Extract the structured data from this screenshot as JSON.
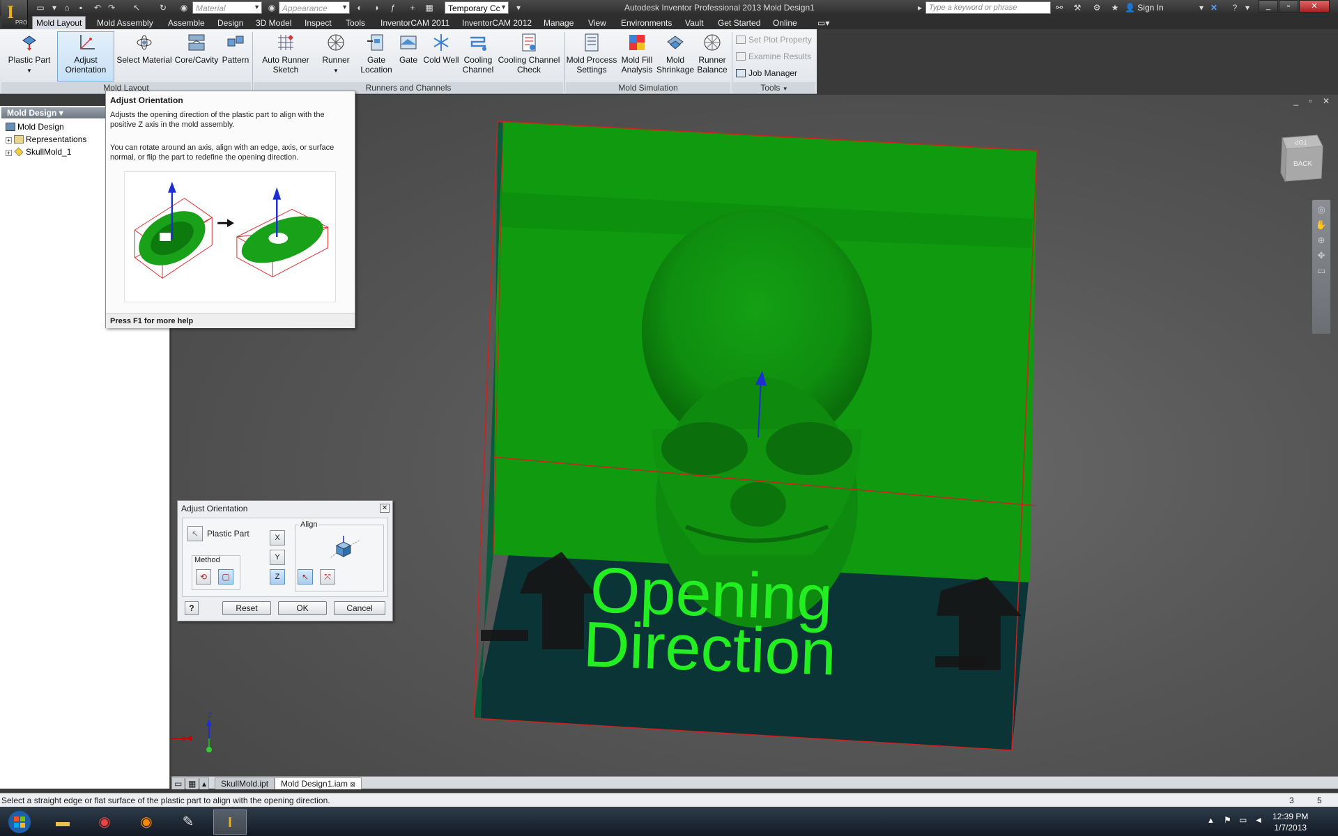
{
  "window": {
    "title": "Autodesk Inventor Professional 2013   Mold Design1",
    "app_badge": "PRO"
  },
  "quick_access": {
    "material_placeholder": "Material",
    "appearance_placeholder": "Appearance",
    "temp_combo": "Temporary Cc"
  },
  "search": {
    "placeholder": "Type a keyword or phrase"
  },
  "user": {
    "signin": "Sign In"
  },
  "tabs": [
    {
      "label": "Mold Layout"
    },
    {
      "label": "Mold Assembly"
    },
    {
      "label": "Assemble"
    },
    {
      "label": "Design"
    },
    {
      "label": "3D Model"
    },
    {
      "label": "Inspect"
    },
    {
      "label": "Tools"
    },
    {
      "label": "InventorCAM 2011"
    },
    {
      "label": "InventorCAM 2012"
    },
    {
      "label": "Manage"
    },
    {
      "label": "View"
    },
    {
      "label": "Environments"
    },
    {
      "label": "Vault"
    },
    {
      "label": "Get Started"
    },
    {
      "label": "Online"
    }
  ],
  "ribbon": {
    "mold_layout": [
      {
        "line1": "Plastic Part",
        "line2": ""
      },
      {
        "line1": "Adjust",
        "line2": "Orientation"
      },
      {
        "line1": "Select Material",
        "line2": ""
      },
      {
        "line1": "Core/Cavity",
        "line2": ""
      },
      {
        "line1": "Pattern",
        "line2": ""
      }
    ],
    "runners": [
      {
        "line1": "Auto Runner",
        "line2": "Sketch"
      },
      {
        "line1": "Runner",
        "line2": ""
      },
      {
        "line1": "Gate",
        "line2": "Location"
      },
      {
        "line1": "Gate",
        "line2": ""
      },
      {
        "line1": "Cold Well",
        "line2": ""
      },
      {
        "line1": "Cooling",
        "line2": "Channel"
      },
      {
        "line1": "Cooling Channel",
        "line2": "Check"
      }
    ],
    "simulation": [
      {
        "line1": "Mold Process",
        "line2": "Settings"
      },
      {
        "line1": "Mold Fill",
        "line2": "Analysis"
      },
      {
        "line1": "Mold",
        "line2": "Shrinkage"
      },
      {
        "line1": "Runner",
        "line2": "Balance"
      }
    ],
    "tools": {
      "set_plot": "Set Plot Property",
      "examine": "Examine Results",
      "job_manager": "Job Manager"
    },
    "panels": {
      "mold_layout": "Mold Layout",
      "runners": "Runners and Channels",
      "simulation": "Mold Simulation",
      "tools": "Tools"
    }
  },
  "browser": {
    "header": "Mold Design",
    "items": [
      {
        "label": "Mold Design"
      },
      {
        "label": "Representations"
      },
      {
        "label": "SkullMold_1"
      }
    ]
  },
  "tooltip": {
    "title": "Adjust Orientation",
    "p1": "Adjusts the opening direction of the plastic part to align with the positive Z axis in the mold assembly.",
    "p2": "You can rotate around an axis, align with an edge, axis, or surface normal, or flip the part to redefine the opening direction.",
    "footer": "Press F1 for more help"
  },
  "dialog": {
    "title": "Adjust Orientation",
    "plastic_part": "Plastic Part",
    "method": "Method",
    "align": "Align",
    "axes": [
      "X",
      "Y",
      "Z"
    ],
    "reset": "Reset",
    "ok": "OK",
    "cancel": "Cancel"
  },
  "viewport": {
    "text_line1": "Opening",
    "text_line2": "Direction",
    "viewcube_top": "TOP",
    "viewcube_back": "BACK",
    "triad_x": "X",
    "triad_z": "Z"
  },
  "doc_tabs": [
    {
      "label": "SkullMold.ipt"
    },
    {
      "label": "Mold Design1.iam"
    }
  ],
  "status": {
    "message": "Select a straight edge or flat surface of the plastic part to align with the opening direction.",
    "count1": "3",
    "count2": "5"
  },
  "clock": {
    "time": "12:39 PM",
    "date": "1/7/2013"
  },
  "colors": {
    "mold_green": "#0f9a0f",
    "mold_dark": "#0b3436",
    "accent_blue": "#1d2fd0",
    "outline_red": "#d02020"
  }
}
